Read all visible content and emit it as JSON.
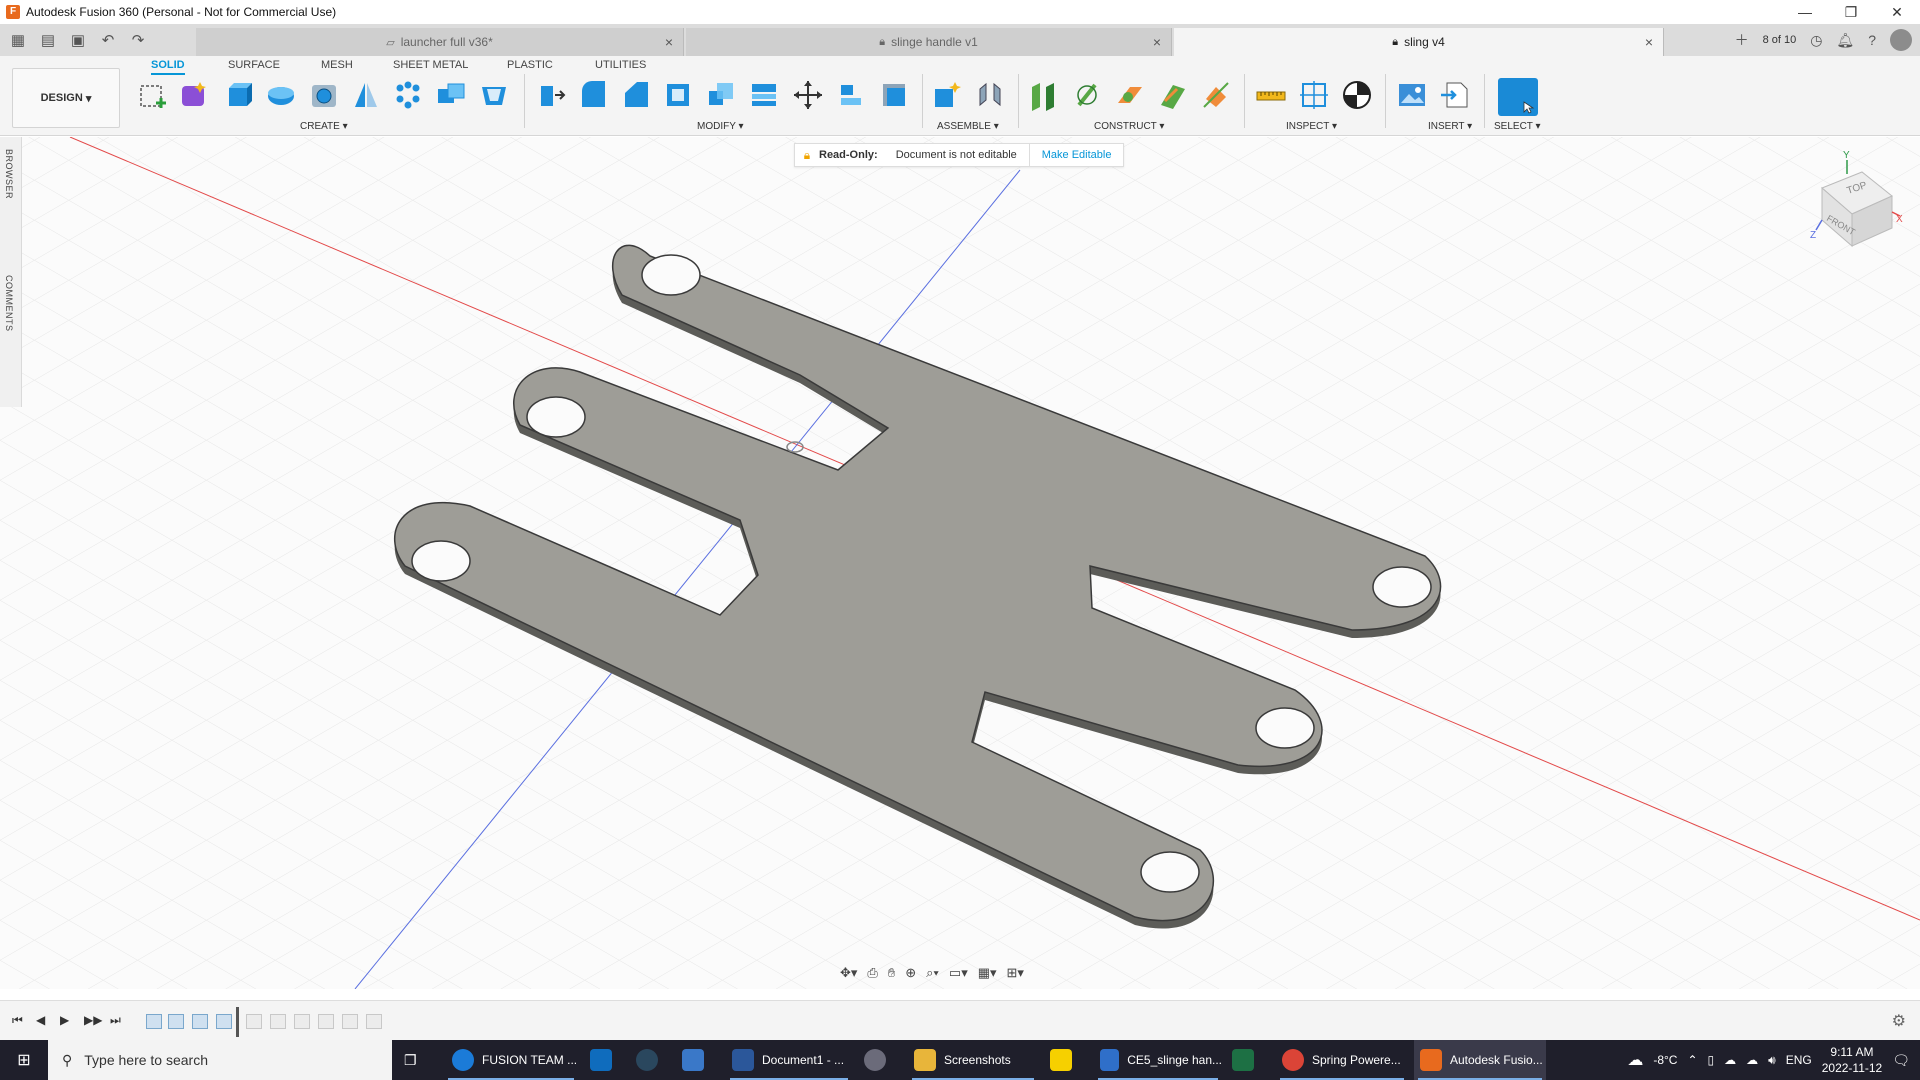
{
  "window": {
    "title": "Autodesk Fusion 360 (Personal - Not for Commercial Use)",
    "min": "—",
    "restore": "❐",
    "close": "✕"
  },
  "doc_tabs": [
    {
      "label": "launcher full v36*",
      "active": false
    },
    {
      "label": "slinge handle v1",
      "active": false
    },
    {
      "label": "sling v4",
      "active": true
    }
  ],
  "tabbar_right": {
    "jobs": "8 of 10"
  },
  "workspace": {
    "design_label": "DESIGN",
    "tabs": [
      "SOLID",
      "SURFACE",
      "MESH",
      "SHEET METAL",
      "PLASTIC",
      "UTILITIES"
    ],
    "active_tab": "SOLID"
  },
  "toolbar_groups": [
    "CREATE",
    "MODIFY",
    "ASSEMBLE",
    "CONSTRUCT",
    "INSPECT",
    "INSERT",
    "SELECT"
  ],
  "side_panel": {
    "browser": "BROWSER",
    "comments": "COMMENTS"
  },
  "readonly": {
    "label": "Read-Only:",
    "message": "Document is not editable",
    "button": "Make Editable"
  },
  "viewcube": {
    "top": "TOP",
    "front": "FRONT",
    "x": "X",
    "y": "Y",
    "z": "Z"
  },
  "taskbar": {
    "search_placeholder": "Type here to search",
    "apps": [
      {
        "label": "FUSION TEAM ...",
        "color": "#1b7bd8"
      },
      {
        "label": "",
        "color": "#0f6cbd"
      },
      {
        "label": "",
        "color": "#2a475e"
      },
      {
        "label": "",
        "color": "#3a78c8"
      },
      {
        "label": "Document1 - ...",
        "color": "#2b579a"
      },
      {
        "label": "",
        "color": "#6b6b7a"
      },
      {
        "label": "Screenshots",
        "color": "#e8b53a"
      },
      {
        "label": "",
        "color": "#f6d000"
      },
      {
        "label": "CE5_slinge han...",
        "color": "#2f6fc9"
      },
      {
        "label": "",
        "color": "#1d7044"
      },
      {
        "label": "Spring Powere...",
        "color": "#db4437"
      },
      {
        "label": "Autodesk Fusio...",
        "color": "#e86a1e"
      }
    ],
    "weather": "-8°C",
    "language": "ENG",
    "time": "9:11 AM",
    "date": "2022-11-12"
  },
  "colors": {
    "accent": "#0696d7",
    "part_fill": "#9e9d97",
    "part_edge": "#3a3a3a",
    "grid": "#e3e3e3",
    "axis_red": "#e34a4a",
    "axis_blue": "#5a6fe0"
  }
}
